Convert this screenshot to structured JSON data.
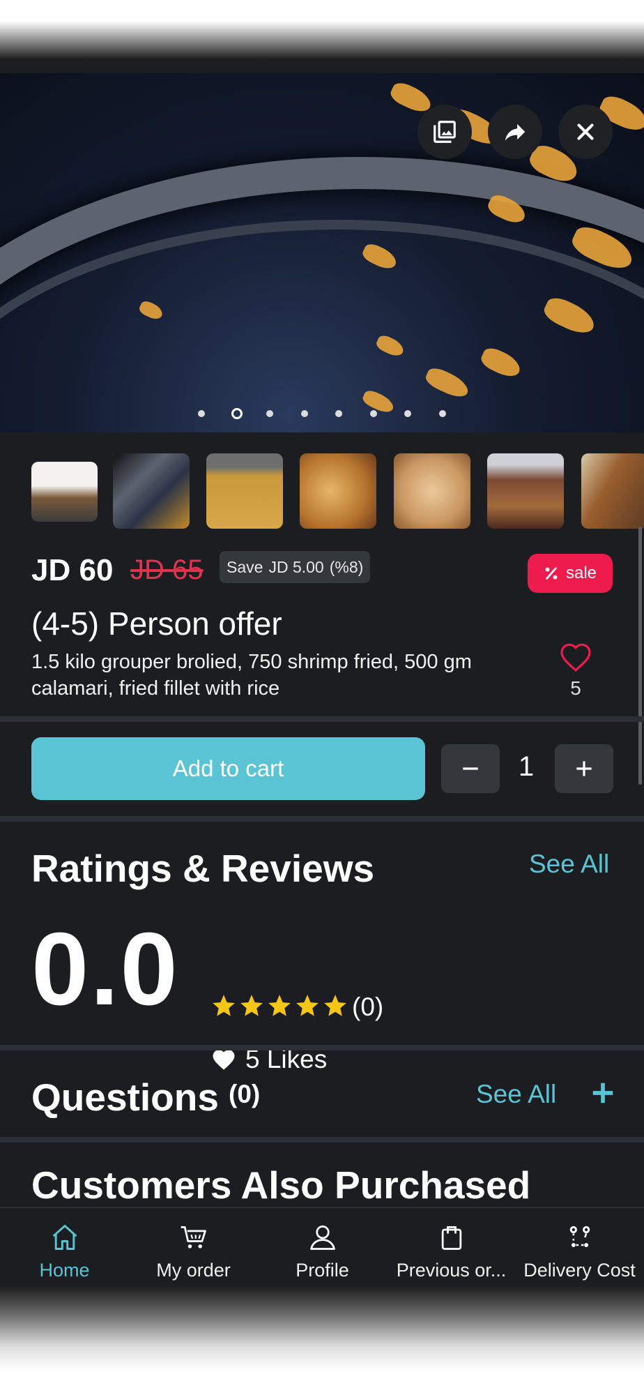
{
  "hero": {
    "buttons": [
      {
        "name": "gallery-icon"
      },
      {
        "name": "share-icon"
      },
      {
        "name": "close-icon"
      }
    ],
    "carousel_count": 8,
    "carousel_active": 2
  },
  "thumbnails": [
    {
      "name": "thumbnail-1",
      "color": "#eae6e2"
    },
    {
      "name": "thumbnail-2",
      "color": "#3c4656"
    },
    {
      "name": "thumbnail-3",
      "color": "#c89a3c"
    },
    {
      "name": "thumbnail-4",
      "color": "#c0863a"
    },
    {
      "name": "thumbnail-5",
      "color": "#d9b48a"
    },
    {
      "name": "thumbnail-6",
      "color": "#7a4a34"
    },
    {
      "name": "thumbnail-7",
      "color": "#9a5e2e"
    }
  ],
  "product": {
    "price": "JD 60",
    "old_price": "JD 65",
    "save_label": "Save",
    "save_amount": "JD 5.00",
    "save_percent": "(%8)",
    "sale_label": "sale",
    "title": "(4-5) Person offer",
    "description": "1.5 kilo grouper brolied, 750 shrimp fried, 500 gm calamari,  fried fillet with rice",
    "likes_count": "5"
  },
  "cart": {
    "add_label": "Add to cart",
    "quantity": "1"
  },
  "ratings": {
    "heading": "Ratings & Reviews",
    "see_all": "See All",
    "score": "0.0",
    "stars": 5,
    "review_count": "(0)",
    "likes_text": "5 Likes"
  },
  "questions": {
    "heading": "Questions",
    "count": "(0)",
    "see_all": "See All"
  },
  "also_purchased": {
    "heading": "Customers Also Purchased"
  },
  "nav": [
    {
      "label": "Home",
      "icon": "home-icon"
    },
    {
      "label": "My order",
      "icon": "cart-icon"
    },
    {
      "label": "Profile",
      "icon": "profile-icon"
    },
    {
      "label": "Previous or...",
      "icon": "bag-icon"
    },
    {
      "label": "Delivery Cost",
      "icon": "route-icon"
    }
  ],
  "colors": {
    "accent": "#5bc4d4",
    "sale": "#ee1c4c",
    "old_price": "#e0344e",
    "star": "#f5c518",
    "background": "#1b1d21"
  }
}
